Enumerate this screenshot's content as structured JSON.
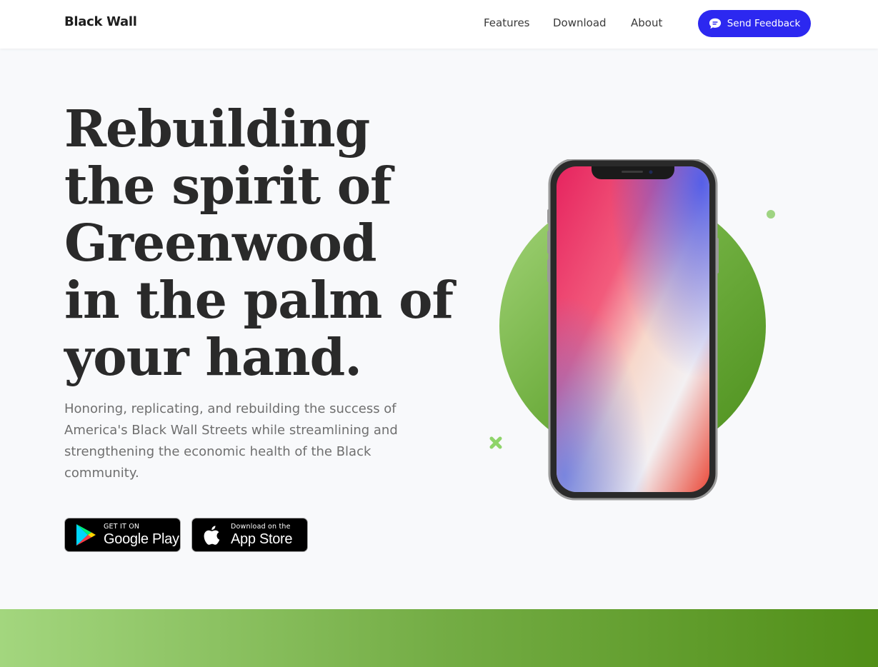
{
  "brand": "Black Wall",
  "nav": {
    "features": "Features",
    "download": "Download",
    "about": "About",
    "feedback_label": "Send Feedback",
    "feedback_icon": "chat-bubble-icon"
  },
  "hero": {
    "title_lines": [
      "Rebuilding",
      "the spirit of",
      "Greenwood",
      "in the palm of",
      "your hand."
    ],
    "subtitle": "Honoring, replicating, and rebuilding the success of America's Black Wall Streets while streamlining and strengthening the economic health of the Black community."
  },
  "stores": {
    "google": {
      "small": "GET IT ON",
      "big": "Google Play",
      "icon": "google-play-icon"
    },
    "apple": {
      "small": "Download on the",
      "big": "App Store",
      "icon": "apple-icon"
    }
  },
  "colors": {
    "accent": "#2c28f0",
    "green_light": "#a4d57a",
    "green_dark": "#4c8f1c"
  }
}
